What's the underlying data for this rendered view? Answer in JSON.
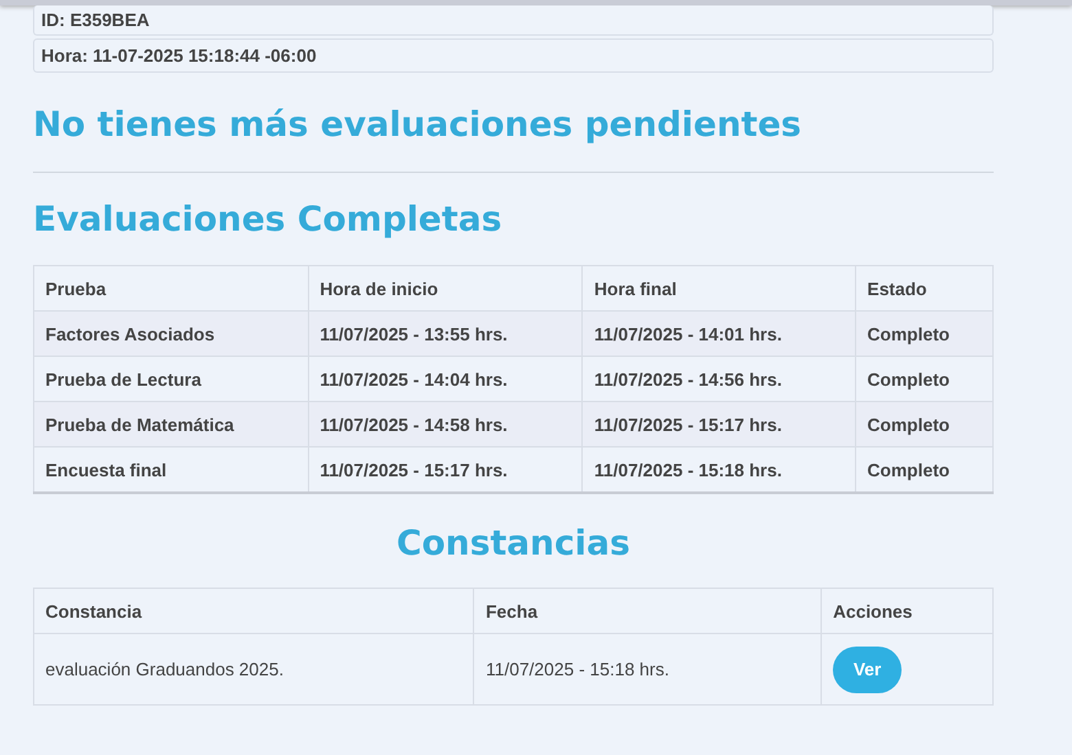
{
  "info": [
    {
      "text": "ID: E359BEA"
    },
    {
      "text": "Hora: 11-07-2025 15:18:44 -06:00"
    }
  ],
  "pending_title": "No tienes más evaluaciones pendientes",
  "completed": {
    "title": "Evaluaciones Completas",
    "columns": [
      "Prueba",
      "Hora de inicio",
      "Hora final",
      "Estado"
    ],
    "rows": [
      [
        "Factores Asociados",
        "11/07/2025 - 13:55 hrs.",
        "11/07/2025 - 14:01 hrs.",
        "Completo"
      ],
      [
        "Prueba de Lectura",
        "11/07/2025 - 14:04 hrs.",
        "11/07/2025 - 14:56 hrs.",
        "Completo"
      ],
      [
        "Prueba de Matemática",
        "11/07/2025 - 14:58 hrs.",
        "11/07/2025 - 15:17 hrs.",
        "Completo"
      ],
      [
        "Encuesta final",
        "11/07/2025 - 15:17 hrs.",
        "11/07/2025 - 15:18 hrs.",
        "Completo"
      ]
    ]
  },
  "certificates": {
    "title": "Constancias",
    "columns": [
      "Constancia",
      "Fecha",
      "Acciones"
    ],
    "rows": [
      {
        "name": "evaluación Graduandos 2025.",
        "date": "11/07/2025 - 15:18 hrs.",
        "action": "Ver"
      }
    ]
  }
}
